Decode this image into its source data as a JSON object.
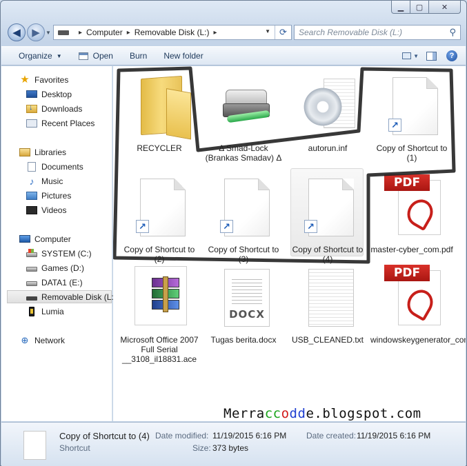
{
  "window": {
    "caption": {
      "minimize": "▁",
      "maximize": "▢",
      "close": "✕"
    }
  },
  "address": {
    "segments": [
      "Computer",
      "Removable Disk (L:)"
    ],
    "search_placeholder": "Search Removable Disk (L:)"
  },
  "toolbar": {
    "organize": "Organize",
    "open": "Open",
    "burn": "Burn",
    "new_folder": "New folder"
  },
  "nav": {
    "favorites": {
      "label": "Favorites",
      "items": [
        "Desktop",
        "Downloads",
        "Recent Places"
      ]
    },
    "libraries": {
      "label": "Libraries",
      "items": [
        "Documents",
        "Music",
        "Pictures",
        "Videos"
      ]
    },
    "computer": {
      "label": "Computer",
      "items": [
        "SYSTEM (C:)",
        "Games (D:)",
        "DATA1 (E:)",
        "Removable Disk (L:)",
        "Lumia"
      ]
    },
    "network": {
      "label": "Network"
    }
  },
  "files": [
    {
      "name": "RECYCLER",
      "kind": "folder"
    },
    {
      "name": "Δ Smad-Lock (Brankas Smadav) Δ",
      "kind": "drive"
    },
    {
      "name": "autorun.inf",
      "kind": "inf"
    },
    {
      "name": "Copy of Shortcut to (1)",
      "kind": "shortcut"
    },
    {
      "name": "Copy of Shortcut to (2)",
      "kind": "shortcut"
    },
    {
      "name": "Copy of Shortcut to (3)",
      "kind": "shortcut"
    },
    {
      "name": "Copy of Shortcut to (4)",
      "kind": "shortcut",
      "selected": true
    },
    {
      "name": "master-cyber_com.pdf",
      "kind": "pdf"
    },
    {
      "name": "Microsoft Office 2007 Full Serial __3108_il18831.ace",
      "kind": "archive"
    },
    {
      "name": "Tugas berita.docx",
      "kind": "docx"
    },
    {
      "name": "USB_CLEANED.txt",
      "kind": "txt"
    },
    {
      "name": "windowskeygenerator_com.pdf",
      "kind": "pdf"
    }
  ],
  "icon_labels": {
    "pdf": "PDF",
    "docx": "DOCX",
    "shortcut_arrow": "↗"
  },
  "watermark": {
    "p1": "Merra",
    "p2": "cc",
    "p3": "o",
    "p4": "dd",
    "p5": "e.blogspot.com"
  },
  "details": {
    "name": "Copy of Shortcut to (4)",
    "type": "Shortcut",
    "modified_label": "Date modified:",
    "modified_value": "11/19/2015 6:16 PM",
    "size_label": "Size:",
    "size_value": "373 bytes",
    "created_label": "Date created:",
    "created_value": "11/19/2015 6:16 PM"
  },
  "colors": {
    "accent": "#1e395b",
    "annotation": "#222222",
    "selection": "#e6e6e6"
  }
}
